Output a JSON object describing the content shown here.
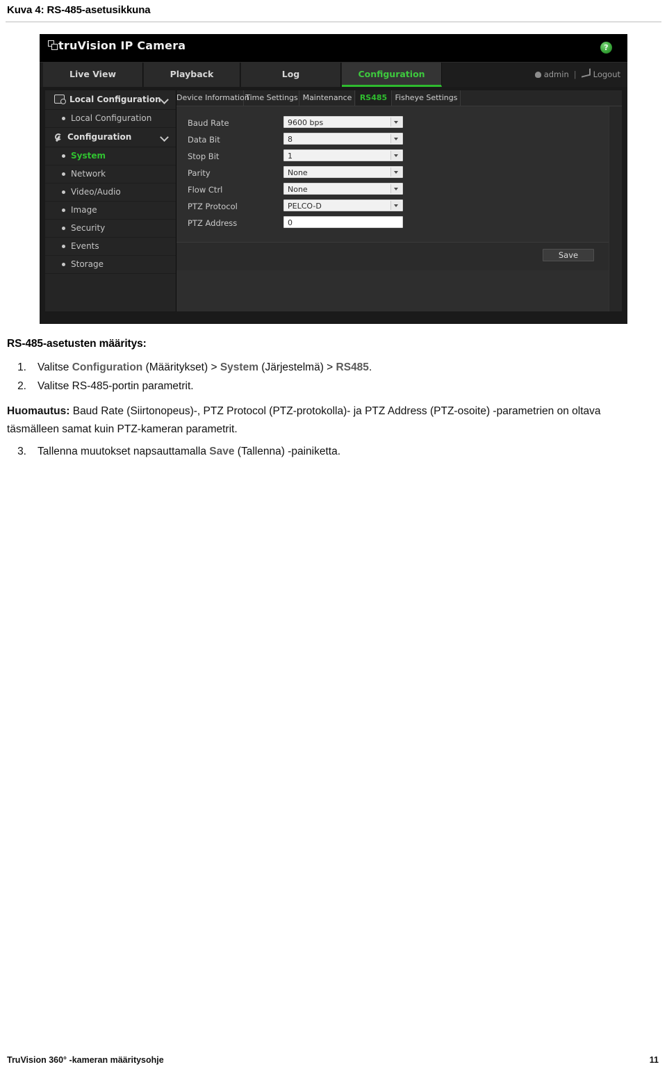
{
  "caption": "Kuva 4: RS-485-asetusikkuna",
  "screenshot": {
    "brand": "truVision  IP Camera",
    "help_icon_label": "?",
    "nav_tabs": [
      {
        "label": "Live View",
        "active": false
      },
      {
        "label": "Playback",
        "active": false
      },
      {
        "label": "Log",
        "active": false
      },
      {
        "label": "Configuration",
        "active": true
      }
    ],
    "user": "admin",
    "user_separator": "|",
    "logout": "Logout",
    "sidebar": [
      {
        "label": "Local Configuration",
        "type": "group",
        "icon": "monitor-icon",
        "chevron": true
      },
      {
        "label": "Local Configuration",
        "type": "item",
        "active": false
      },
      {
        "label": "Configuration",
        "type": "group",
        "icon": "wrench-icon",
        "chevron": true
      },
      {
        "label": "System",
        "type": "item",
        "active": true
      },
      {
        "label": "Network",
        "type": "item",
        "active": false
      },
      {
        "label": "Video/Audio",
        "type": "item",
        "active": false
      },
      {
        "label": "Image",
        "type": "item",
        "active": false
      },
      {
        "label": "Security",
        "type": "item",
        "active": false
      },
      {
        "label": "Events",
        "type": "item",
        "active": false
      },
      {
        "label": "Storage",
        "type": "item",
        "active": false
      }
    ],
    "subtabs": [
      {
        "label": "Device Information",
        "active": false
      },
      {
        "label": "Time Settings",
        "active": false
      },
      {
        "label": "Maintenance",
        "active": false
      },
      {
        "label": "RS485",
        "active": true
      },
      {
        "label": "Fisheye Settings",
        "active": false
      }
    ],
    "fields": [
      {
        "label": "Baud Rate",
        "value": "9600 bps",
        "control": "select"
      },
      {
        "label": "Data Bit",
        "value": "8",
        "control": "select"
      },
      {
        "label": "Stop Bit",
        "value": "1",
        "control": "select"
      },
      {
        "label": "Parity",
        "value": "None",
        "control": "select"
      },
      {
        "label": "Flow Ctrl",
        "value": "None",
        "control": "select"
      },
      {
        "label": "PTZ Protocol",
        "value": "PELCO-D",
        "control": "select"
      },
      {
        "label": "PTZ Address",
        "value": "0",
        "control": "text"
      }
    ],
    "save_label": "Save",
    "accent_green": "#2fbb2f"
  },
  "doc": {
    "section_title": "RS-485-asetusten määritys:",
    "steps": [
      {
        "num": "1.",
        "parts": [
          {
            "t": "Valitse ",
            "k": false
          },
          {
            "t": "Configuration",
            "k": true
          },
          {
            "t": " (Määritykset) > ",
            "k": false
          },
          {
            "t": "System",
            "k": true
          },
          {
            "t": " (Järjestelmä) > ",
            "k": false
          },
          {
            "t": "RS485",
            "k": true
          },
          {
            "t": ".",
            "k": false
          }
        ]
      },
      {
        "num": "2.",
        "parts": [
          {
            "t": "Valitse RS-485-portin parametrit.",
            "k": false
          }
        ]
      }
    ],
    "note_label": "Huomautus:",
    "note_text": " Baud Rate (Siirtonopeus)-, PTZ Protocol (PTZ-protokolla)- ja PTZ Address (PTZ-osoite) -parametrien on oltava täsmälleen samat kuin PTZ-kameran parametrit.",
    "step3": {
      "num": "3.",
      "parts": [
        {
          "t": "Tallenna muutokset napsauttamalla ",
          "k": false
        },
        {
          "t": "Save",
          "k": true
        },
        {
          "t": " (Tallenna) -painiketta.",
          "k": false
        }
      ]
    }
  },
  "footer": {
    "left": "TruVision 360° -kameran määritysohje",
    "page": "11"
  }
}
